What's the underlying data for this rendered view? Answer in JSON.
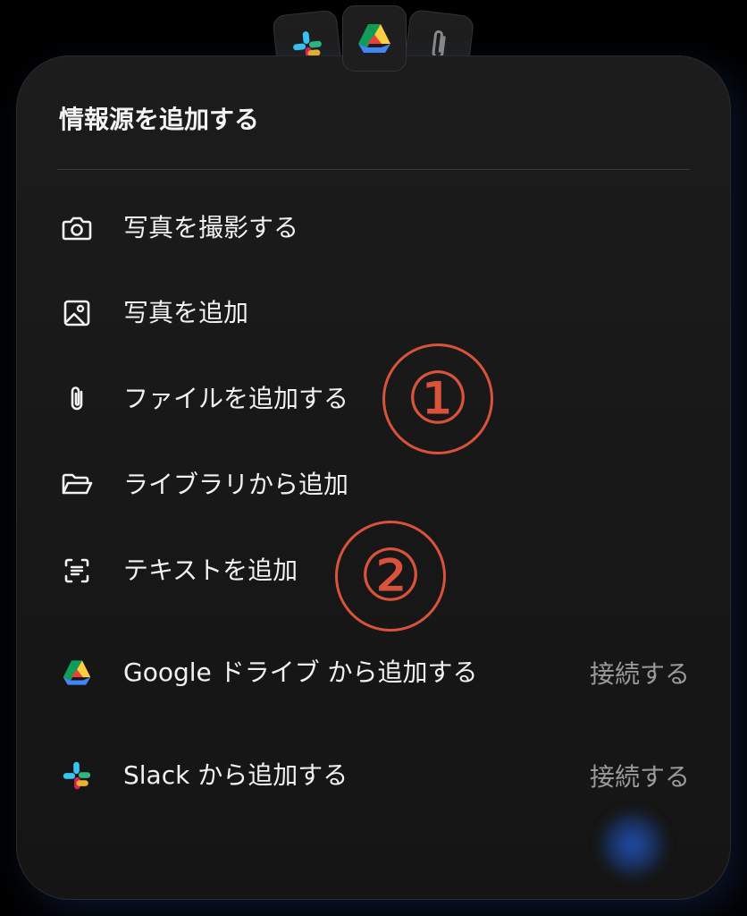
{
  "sheet": {
    "title": "情報源を追加する"
  },
  "items": [
    {
      "label": "写真を撮影する",
      "icon": "camera-icon"
    },
    {
      "label": "写真を追加",
      "icon": "image-icon"
    },
    {
      "label": "ファイルを追加する",
      "icon": "paperclip-icon"
    },
    {
      "label": "ライブラリから追加",
      "icon": "folder-icon"
    },
    {
      "label": "テキストを追加",
      "icon": "text-scan-icon"
    },
    {
      "label": "Google ドライブ から追加する",
      "icon": "google-drive-icon",
      "action": "接続する"
    },
    {
      "label": "Slack から追加する",
      "icon": "slack-icon",
      "action": "接続する"
    }
  ],
  "annotations": [
    "①",
    "②"
  ],
  "peek_icons": [
    "slack-icon",
    "google-drive-icon",
    "paperclip-icon"
  ],
  "colors": {
    "background": "#000000",
    "sheet": "#1a1a1a",
    "annotation": "#d9533b",
    "muted_text": "#9a9a9a"
  }
}
